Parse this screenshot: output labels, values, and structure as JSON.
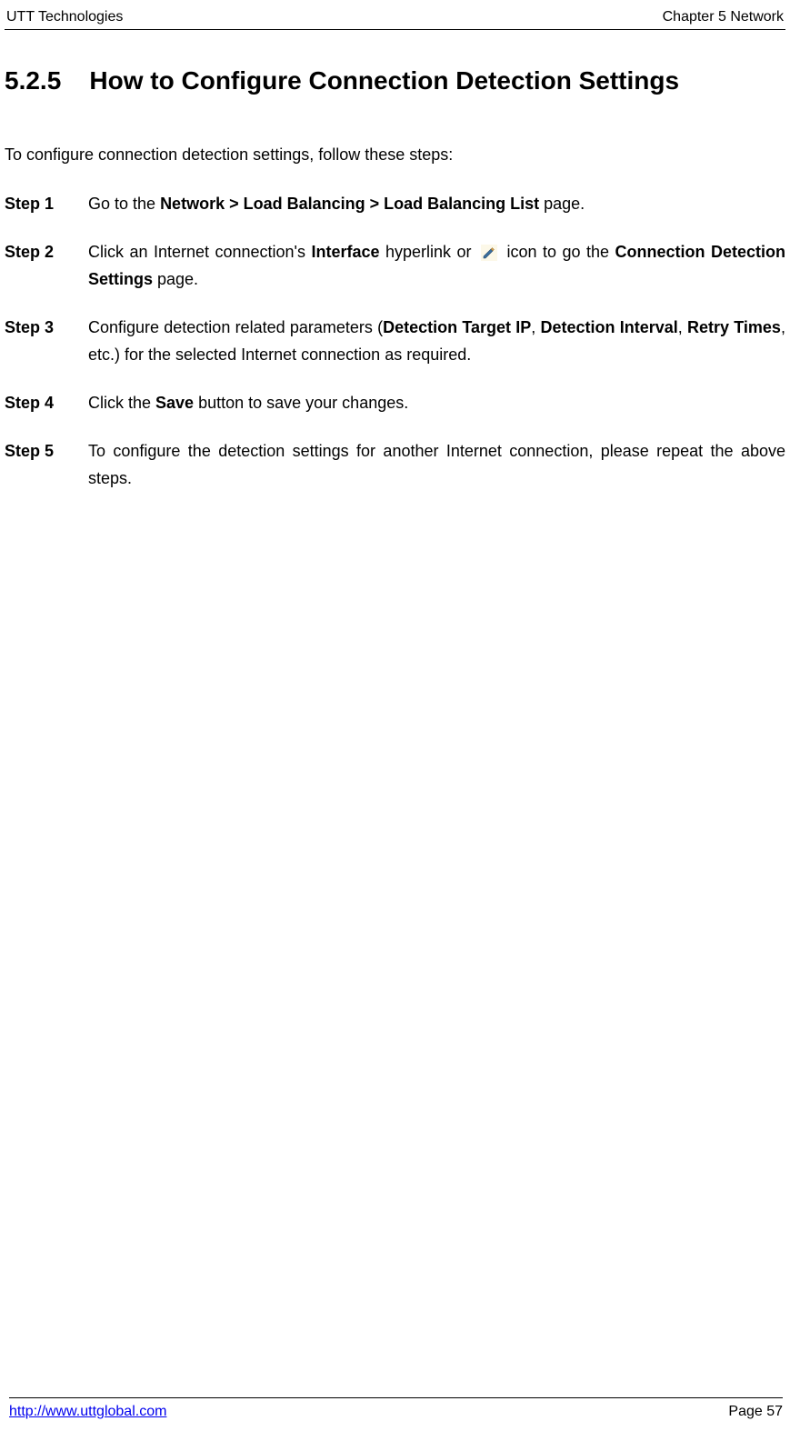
{
  "header": {
    "left": "UTT Technologies",
    "right": "Chapter 5 Network"
  },
  "section": {
    "number": "5.2.5",
    "title": "How to Configure Connection Detection Settings"
  },
  "intro": "To configure connection detection settings, follow these steps:",
  "steps": {
    "s1": {
      "label": "Step 1",
      "pre": "Go to the ",
      "bold": "Network > Load Balancing > Load Balancing List",
      "post": " page."
    },
    "s2": {
      "label": "Step 2",
      "pre": "Click an Internet connection's ",
      "b1": "Interface",
      "mid": " hyperlink or ",
      "post": " icon to go the ",
      "b2": "Connection Detection Settings",
      "tail": " page."
    },
    "s3": {
      "label": "Step 3",
      "pre": "Configure detection related parameters (",
      "b1": "Detection Target IP",
      "c1": ", ",
      "b2": "Detection Interval",
      "c2": ", ",
      "b3": "Retry Times",
      "post": ", etc.) for the selected Internet connection as required."
    },
    "s4": {
      "label": "Step 4",
      "pre": "Click the ",
      "b1": "Save",
      "post": " button to save your changes."
    },
    "s5": {
      "label": "Step 5",
      "text": "To configure the detection settings for another Internet connection, please repeat the above steps."
    }
  },
  "footer": {
    "link": "http://www.uttglobal.com",
    "page": "Page 57"
  }
}
